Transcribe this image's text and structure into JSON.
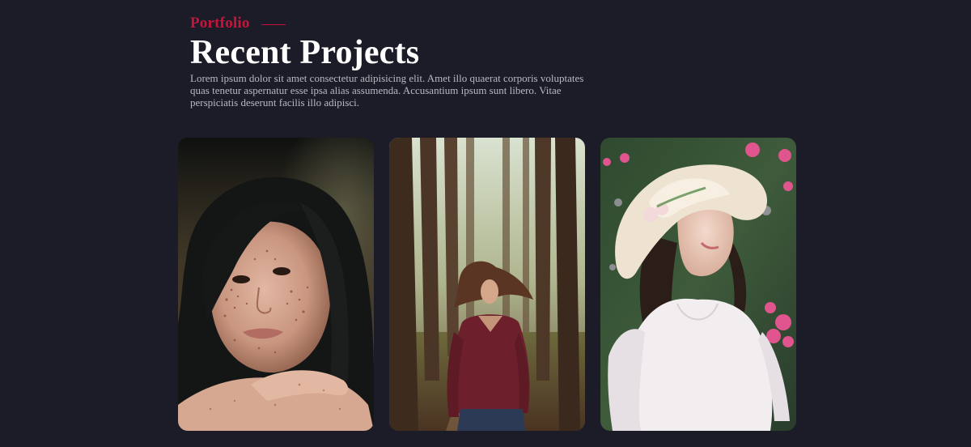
{
  "header": {
    "eyebrow": "Portfolio",
    "title": "Recent Projects",
    "description": "Lorem ipsum dolor sit amet consectetur adipisicing elit. Amet illo quaerat corporis voluptates quas tenetur aspernatur esse ipsa alias assumenda. Accusantium ipsum sunt libero. Vitae perspiciatis deserunt facilis illo adipisci."
  },
  "colors": {
    "background": "#1b1c27",
    "accent": "#c8143c",
    "title": "#ffffff",
    "body_text": "#b7b8c2"
  },
  "gallery": {
    "projects": [
      {
        "photo": "portrait-woman-freckles"
      },
      {
        "photo": "woman-red-sweater-forest-path"
      },
      {
        "photo": "woman-sun-hat-flowers"
      }
    ]
  }
}
